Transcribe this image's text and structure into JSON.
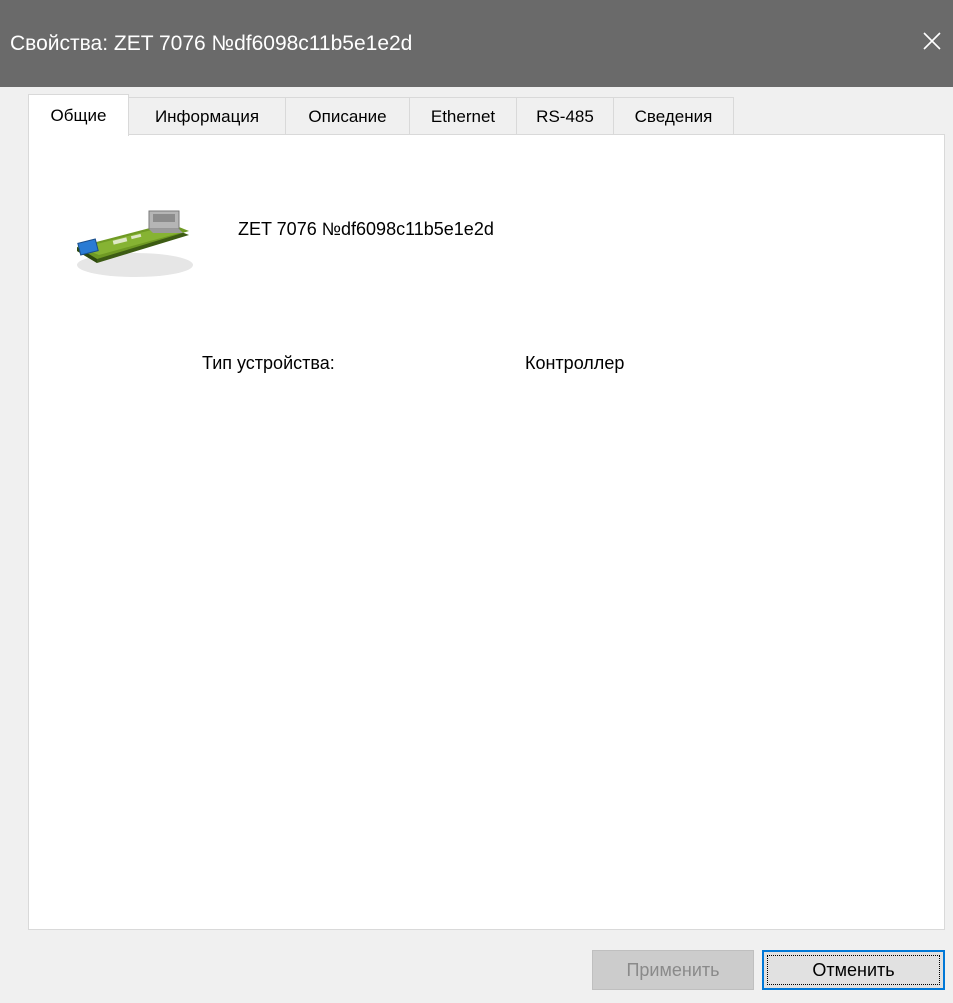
{
  "window": {
    "title": "Свойства: ZET 7076 №df6098c11b5e1e2d",
    "close_icon": "close-icon"
  },
  "tabs": [
    {
      "label": "Общие",
      "active": true
    },
    {
      "label": "Информация",
      "active": false
    },
    {
      "label": "Описание",
      "active": false
    },
    {
      "label": "Ethernet",
      "active": false
    },
    {
      "label": "RS-485",
      "active": false
    },
    {
      "label": "Сведения",
      "active": false
    }
  ],
  "general": {
    "device_icon": "device-board-icon",
    "device_name": "ZET 7076 №df6098c11b5e1e2d",
    "device_type_label": "Тип устройства:",
    "device_type_value": "Контроллер"
  },
  "buttons": {
    "apply": "Применить",
    "apply_enabled": false,
    "cancel": "Отменить"
  },
  "colors": {
    "titlebar": "#6a6a6a",
    "accent": "#0078d7"
  }
}
